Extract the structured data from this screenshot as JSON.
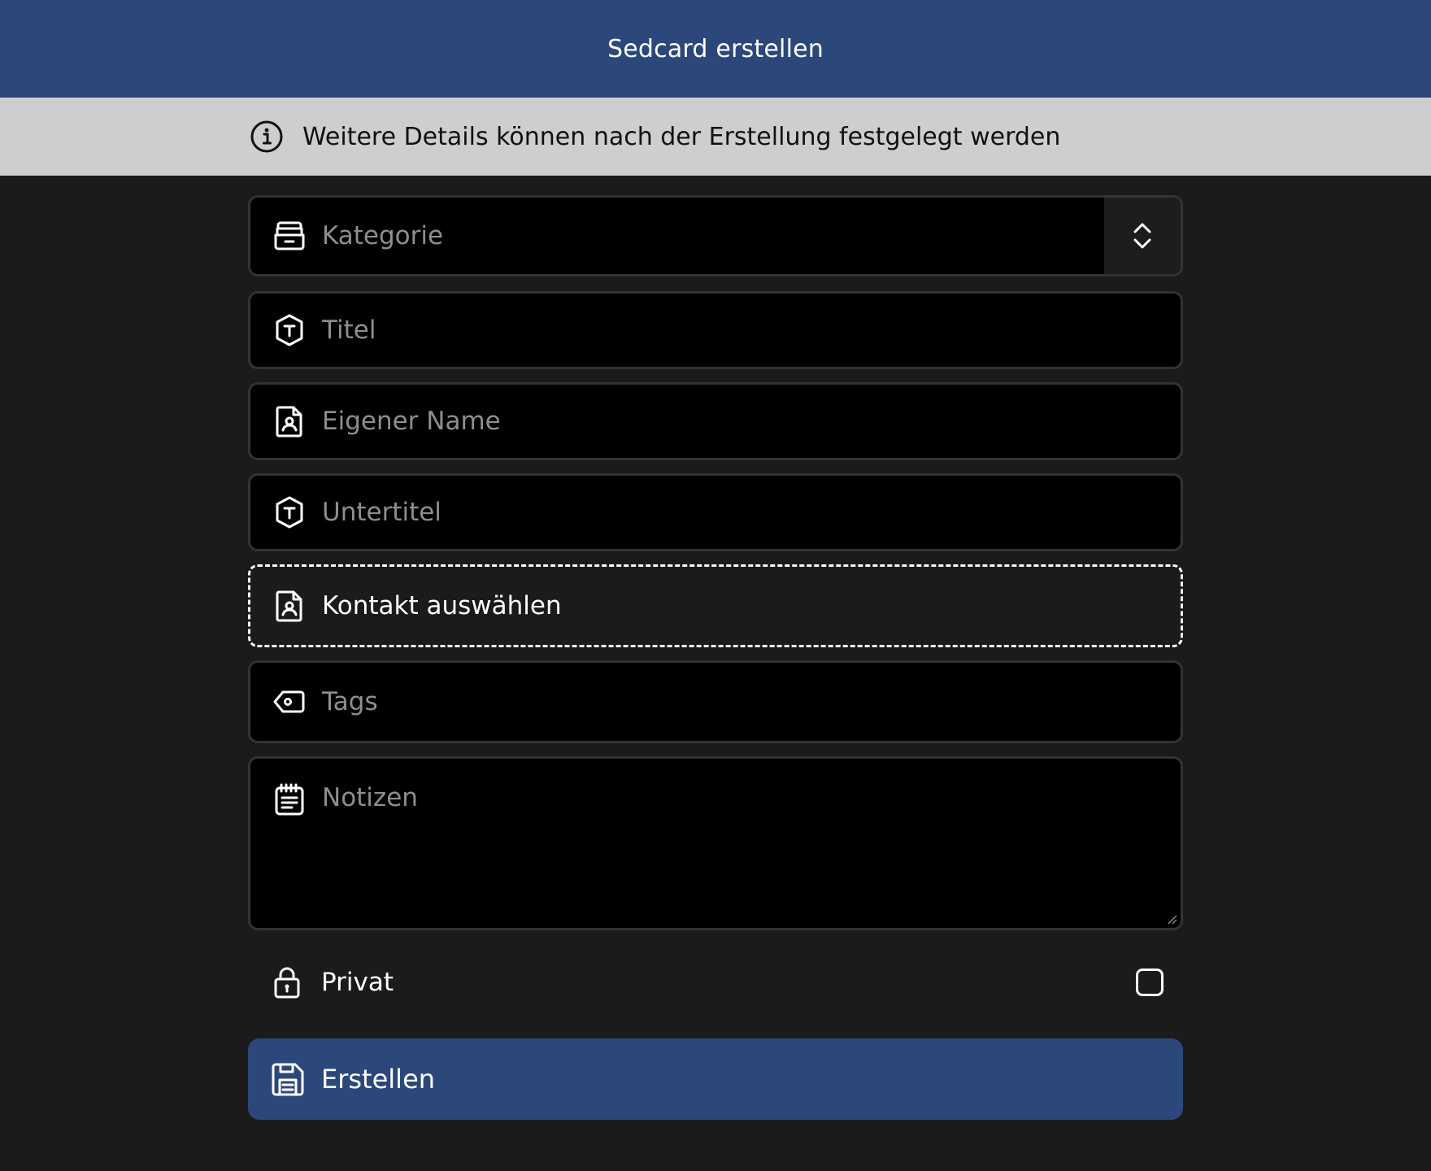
{
  "header": {
    "title": "Sedcard erstellen"
  },
  "info": {
    "text": "Weitere Details können nach der Erstellung festgelegt werden",
    "icon": "info-icon"
  },
  "form": {
    "category": {
      "placeholder": "Kategorie",
      "icon": "category-icon"
    },
    "title": {
      "placeholder": "Titel",
      "icon": "text-hexagon-icon"
    },
    "own_name": {
      "placeholder": "Eigener Name",
      "icon": "contact-file-icon"
    },
    "subtitle": {
      "placeholder": "Untertitel",
      "icon": "text-hexagon-icon"
    },
    "contact": {
      "label": "Kontakt auswählen",
      "icon": "contact-file-icon"
    },
    "tags": {
      "placeholder": "Tags",
      "icon": "tag-icon"
    },
    "notes": {
      "placeholder": "Notizen",
      "icon": "notes-icon"
    },
    "private": {
      "label": "Privat",
      "checked": false,
      "icon": "lock-icon"
    },
    "submit": {
      "label": "Erstellen",
      "icon": "save-icon"
    }
  },
  "colors": {
    "header": "#2c477a",
    "info_bar": "#cecece",
    "background": "#1b1b1b",
    "field": "#000000",
    "field_border": "#333333",
    "placeholder": "#8e8e8e"
  }
}
